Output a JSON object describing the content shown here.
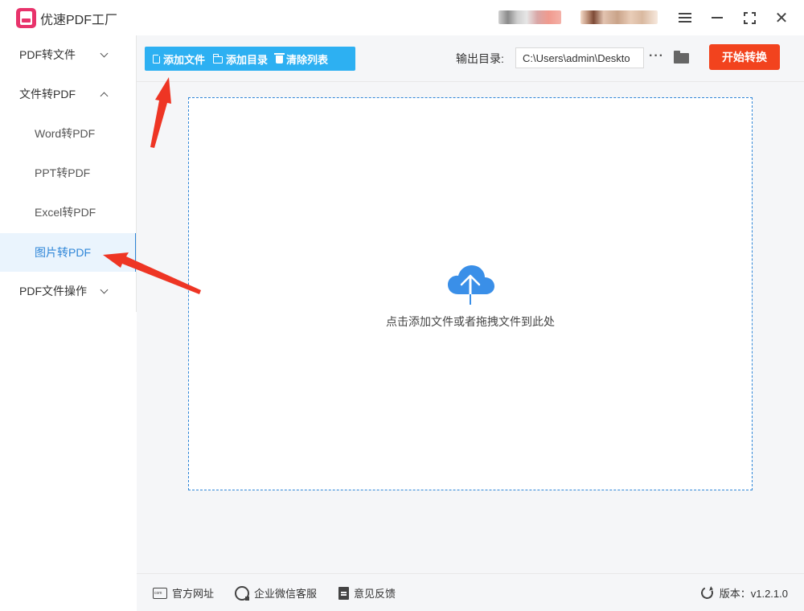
{
  "app": {
    "title": "优速PDF工厂",
    "logo_icon": "pdf-logo-icon",
    "brand_color": "#e8336b"
  },
  "window_controls": {
    "menu_icon": "hamburger-menu-icon",
    "minimize_icon": "minimize-icon",
    "maximize_icon": "maximize-icon",
    "close_icon": "close-icon"
  },
  "sidebar": {
    "items": [
      {
        "label": "PDF转文件",
        "expanded": false
      },
      {
        "label": "文件转PDF",
        "expanded": true,
        "children": [
          {
            "label": "Word转PDF",
            "active": false
          },
          {
            "label": "PPT转PDF",
            "active": false
          },
          {
            "label": "Excel转PDF",
            "active": false
          },
          {
            "label": "图片转PDF",
            "active": true
          }
        ]
      },
      {
        "label": "PDF文件操作",
        "expanded": false
      }
    ],
    "active_color": "#2f86d8"
  },
  "toolbar": {
    "add_file_label": "添加文件",
    "add_folder_label": "添加目录",
    "clear_list_label": "清除列表",
    "button_color": "#2db0f2",
    "output_label": "输出目录:",
    "output_path": "C:\\Users\\admin\\Deskto",
    "more_label": "···",
    "start_label": "开始转换",
    "start_color": "#f2431e"
  },
  "dropzone": {
    "hint": "点击添加文件或者拖拽文件到此处",
    "icon": "cloud-upload-icon",
    "icon_color": "#3a8fe8"
  },
  "footer": {
    "website_label": "官方网址",
    "service_label": "企业微信客服",
    "feedback_label": "意见反馈",
    "version_label": "版本：v1.2.1.0"
  },
  "annotations": {
    "arrow_color": "#ee3524"
  }
}
